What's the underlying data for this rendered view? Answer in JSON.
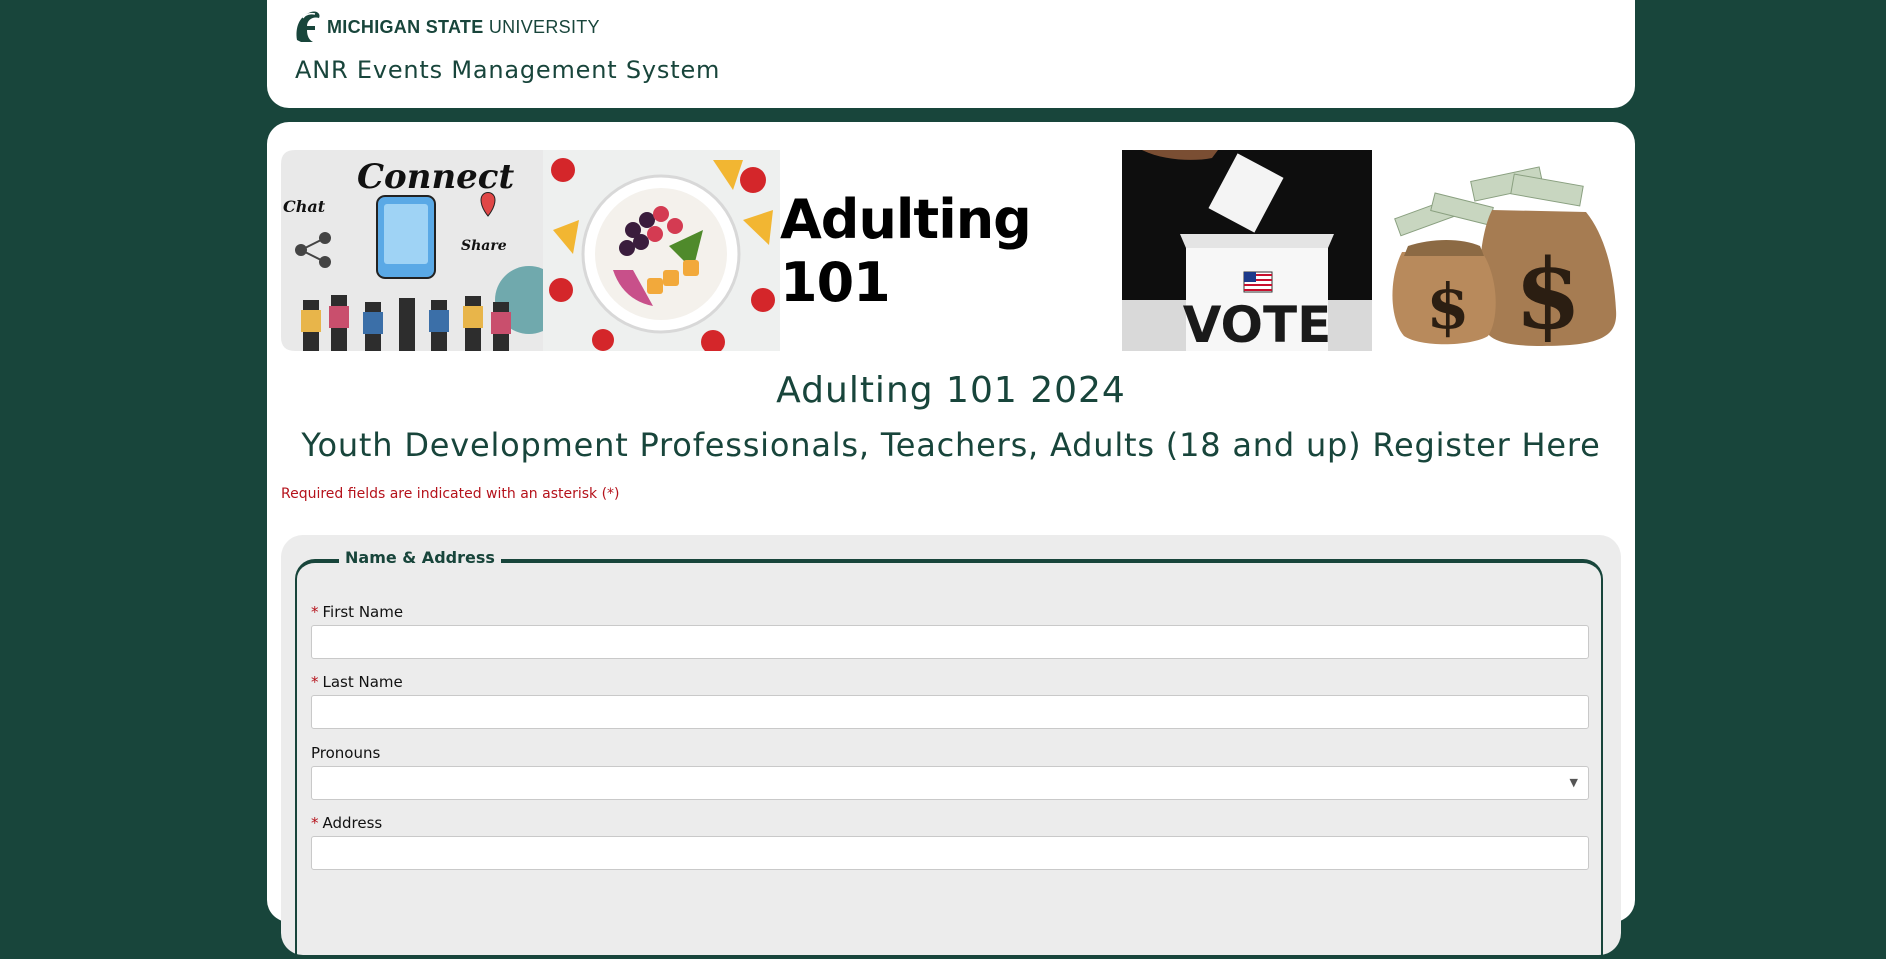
{
  "header": {
    "logo": {
      "bold_text": "MICHIGAN STATE",
      "light_text": " UNIVERSITY"
    },
    "system_title": "ANR Events Management System"
  },
  "banner": {
    "center_text": "Adulting 101",
    "panels": [
      "Connect",
      "Chat",
      "Share",
      "VOTE"
    ]
  },
  "event": {
    "title": "Adulting 101 2024",
    "subtitle": "Youth Development Professionals, Teachers, Adults (18 and up) Register Here",
    "required_note": "Required fields are indicated with an asterisk (*)"
  },
  "form": {
    "legend": "Name & Address",
    "fields": [
      {
        "label": "First Name",
        "required": true,
        "value": ""
      },
      {
        "label": "Last Name",
        "required": true,
        "value": ""
      },
      {
        "label": "Pronouns",
        "required": false,
        "value": ""
      },
      {
        "label": "Address",
        "required": true,
        "value": ""
      }
    ],
    "required_marker": "*"
  },
  "colors": {
    "brand_green": "#18453b",
    "required_red": "#b5121b",
    "panel_gray": "#ececec"
  }
}
